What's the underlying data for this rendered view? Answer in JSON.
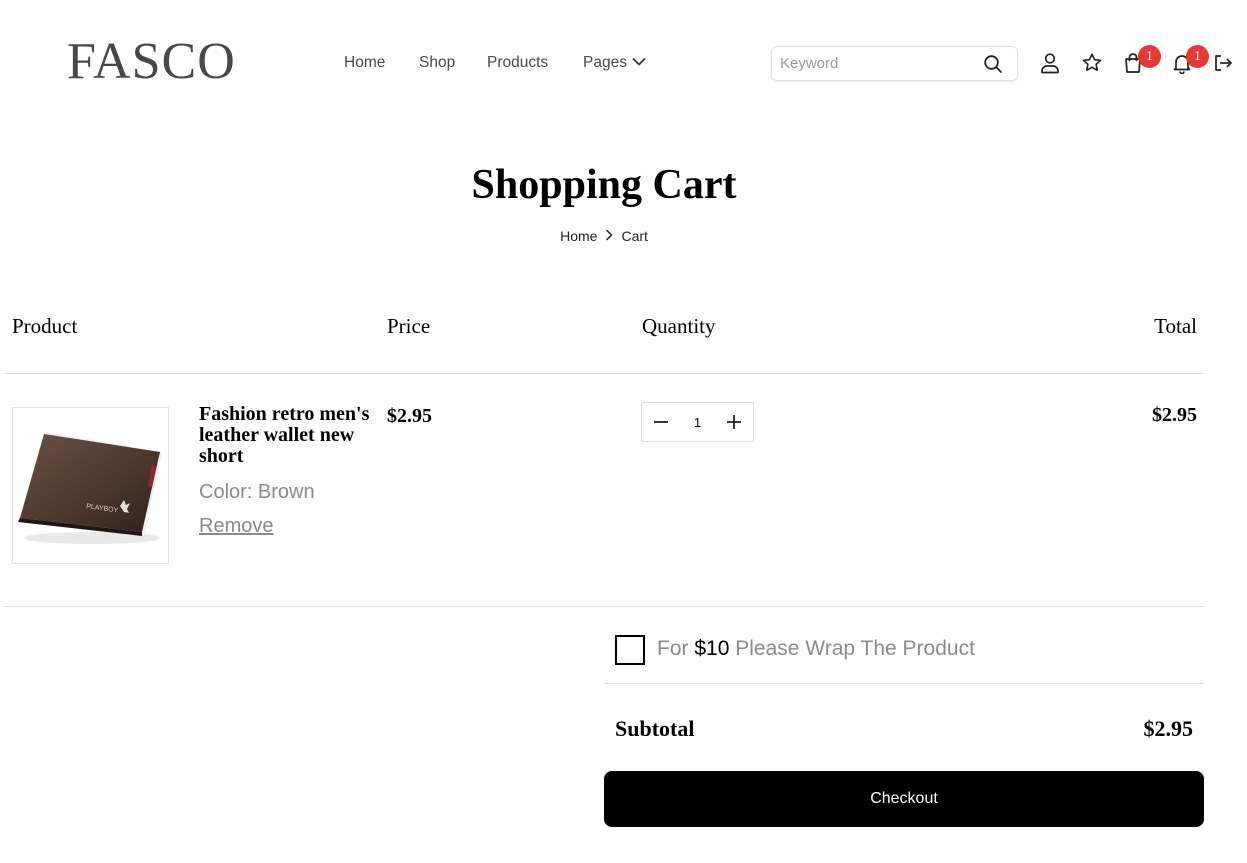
{
  "header": {
    "logo": "FASCO",
    "nav": {
      "home": "Home",
      "shop": "Shop",
      "products": "Products",
      "pages": "Pages"
    },
    "search": {
      "placeholder": "Keyword",
      "value": ""
    },
    "cart_count": "1",
    "notification_count": "1"
  },
  "page": {
    "title": "Shopping Cart",
    "breadcrumb": {
      "home": "Home",
      "current": "Cart"
    }
  },
  "table": {
    "headers": {
      "product": "Product",
      "price": "Price",
      "quantity": "Quantity",
      "total": "Total"
    },
    "rows": [
      {
        "name": "Fashion retro men's leather wallet new short",
        "color": "Color: Brown",
        "remove": "Remove",
        "price": "$2.95",
        "quantity": "1",
        "total": "$2.95"
      }
    ]
  },
  "summary": {
    "wrap_prefix": "For",
    "wrap_price": "$10",
    "wrap_suffix": "Please Wrap The Product",
    "subtotal_label": "Subtotal",
    "subtotal_value": "$2.95",
    "checkout_label": "Checkout"
  },
  "colors": {
    "badge": "#e53935",
    "text_muted": "#8a8a8a",
    "button": "#000000"
  }
}
